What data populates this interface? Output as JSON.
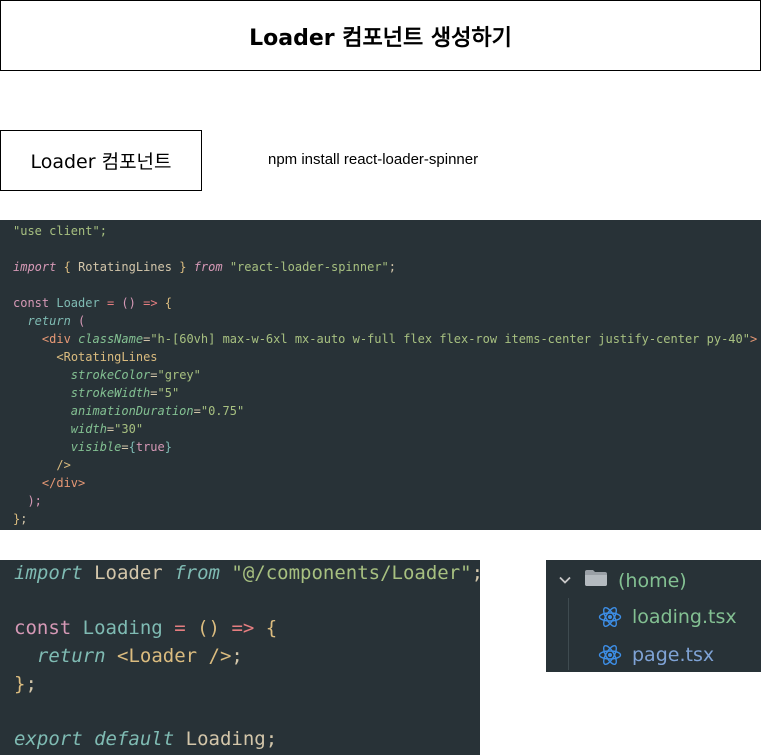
{
  "page_title": "Loader 컴포넌트 생성하기",
  "section_label": "Loader 컴포넌트",
  "install_command": "npm install react-loader-spinner",
  "code_loader": {
    "directive": "\"use client\";",
    "import_kw": "import",
    "import_name": "RotatingLines",
    "from_kw": "from",
    "import_src": "\"react-loader-spinner\"",
    "const_kw": "const",
    "component_name": "Loader",
    "return_kw": "return",
    "div_tag": "div",
    "classname_attr": "className",
    "classname_value": "\"h-[60vh] max-w-6xl mx-auto w-full flex flex-row items-center justify-center py-40\"",
    "spinner_tag": "RotatingLines",
    "props": [
      {
        "name": "strokeColor",
        "value": "\"grey\""
      },
      {
        "name": "strokeWidth",
        "value": "\"5\""
      },
      {
        "name": "animationDuration",
        "value": "\"0.75\""
      },
      {
        "name": "width",
        "value": "\"30\""
      }
    ],
    "visible_attr": "visible",
    "visible_value": "true"
  },
  "code_loading": {
    "import_kw": "import",
    "import_name": "Loader",
    "from_kw": "from",
    "import_src": "\"@/components/Loader\"",
    "const_kw": "const",
    "component_name": "Loading",
    "return_kw": "return",
    "return_tag": "Loader",
    "export_kw": "export",
    "default_kw": "default",
    "export_name": "Loading"
  },
  "file_tree": {
    "folder": "(home)",
    "files": [
      "loading.tsx",
      "page.tsx"
    ]
  },
  "colors": {
    "editor_bg": "#283237",
    "react_icon": "#3d8ee6"
  }
}
